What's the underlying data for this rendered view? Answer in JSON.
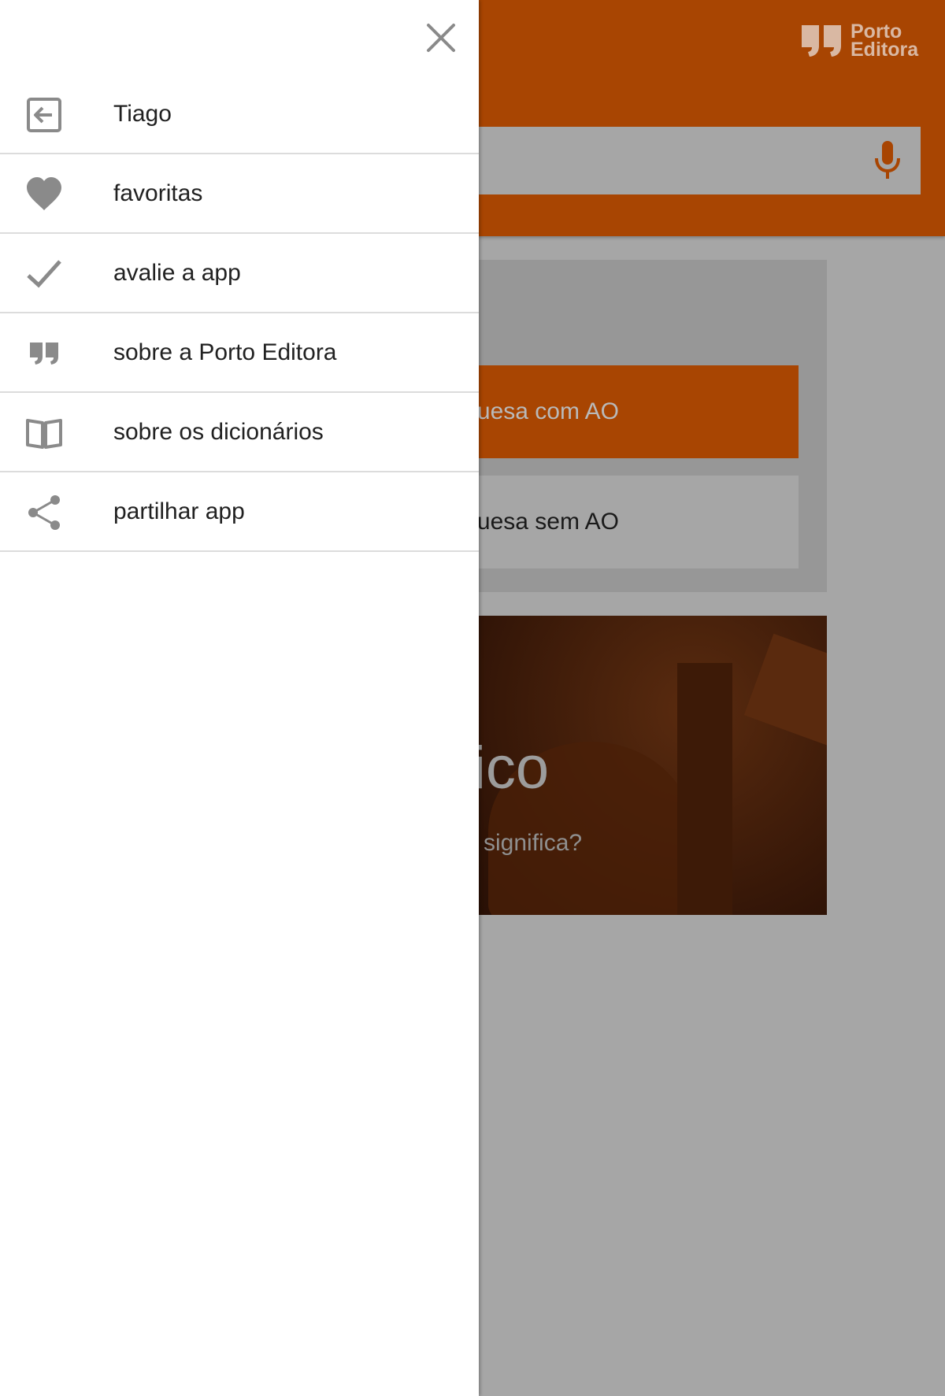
{
  "app": {
    "brand": {
      "name": "Porto\nEditora"
    },
    "buttons": {
      "with_ao": "uesa com AO",
      "without_ao": "uesa sem AO"
    },
    "promo": {
      "title": "ico",
      "subtitle": "significa?"
    }
  },
  "drawer": {
    "items": [
      {
        "label": "Tiago",
        "icon": "login-icon"
      },
      {
        "label": "favoritas",
        "icon": "heart-icon"
      },
      {
        "label": "avalie a app",
        "icon": "checkmark-icon"
      },
      {
        "label": "sobre a Porto Editora",
        "icon": "quote-icon"
      },
      {
        "label": "sobre os dicionários",
        "icon": "book-icon"
      },
      {
        "label": "partilhar app",
        "icon": "share-icon"
      }
    ]
  },
  "colors": {
    "header": "#a84502",
    "icon_gray": "#8a8a8a",
    "overlay_gray": "#a6a6a6"
  }
}
